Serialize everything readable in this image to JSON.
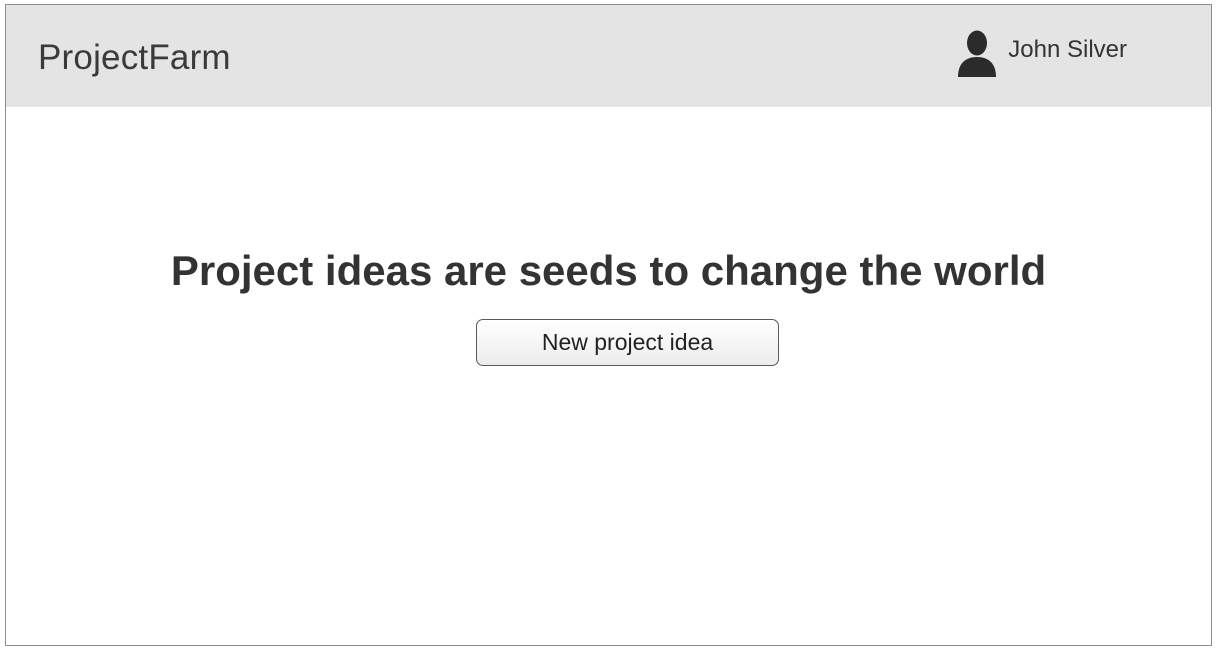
{
  "header": {
    "brand": "ProjectFarm",
    "user": {
      "name": "John Silver",
      "icon": "user-silhouette-icon"
    }
  },
  "main": {
    "headline": "Project ideas are seeds to change the world",
    "cta_label": "New project idea"
  },
  "colors": {
    "header_bg": "#e4e4e4",
    "text": "#333333",
    "border": "#8c8c8c"
  }
}
